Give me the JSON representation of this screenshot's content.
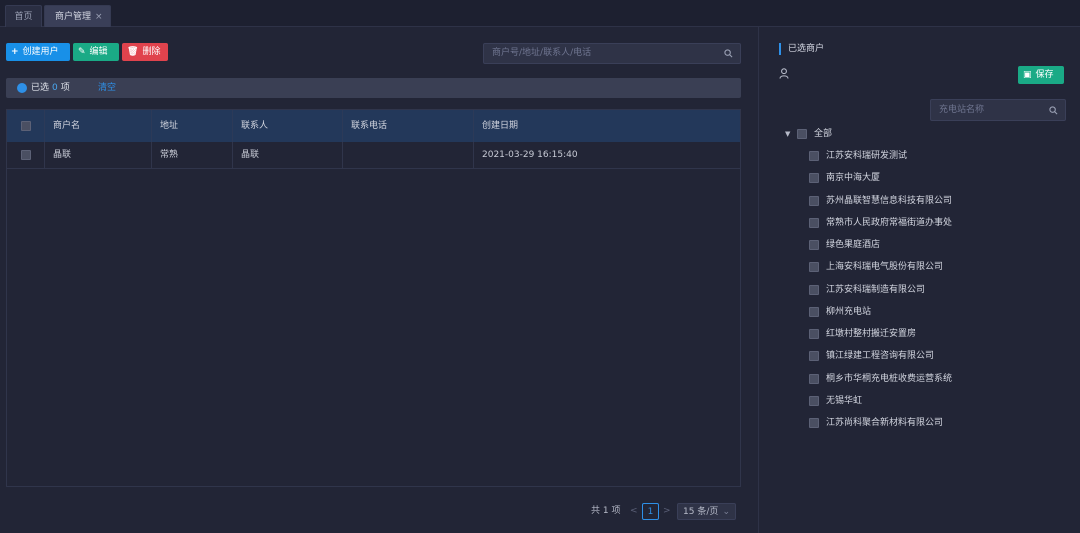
{
  "tabs": {
    "home": "首页",
    "active": "商户管理",
    "close": "×"
  },
  "toolbar": {
    "create_label": "创建用户",
    "edit_label": "编辑",
    "delete_label": "删除",
    "search_placeholder": "商户号/地址/联系人/电话"
  },
  "selection": {
    "prefix": "已选",
    "count": "0",
    "suffix": "项",
    "clear_label": "清空"
  },
  "table": {
    "headers": [
      "商户名",
      "地址",
      "联系人",
      "联系电话",
      "创建日期"
    ],
    "rows": [
      {
        "name": "晶联",
        "address": "常熟",
        "contact": "晶联",
        "phone": "",
        "created": "2021-03-29 16:15:40"
      }
    ]
  },
  "pagination": {
    "total": "共 1 项",
    "prev": "<",
    "current": "1",
    "next": ">",
    "page_size": "15 条/页"
  },
  "side": {
    "title": "已选商户",
    "save_label": "保存",
    "search_placeholder": "充电站名称",
    "tree_root": "全部",
    "stations": [
      "江苏安科瑞研发测试",
      "南京中海大厦",
      "苏州晶联智慧信息科技有限公司",
      "常熟市人民政府常福街道办事处",
      "绿色果庭酒店",
      "上海安科瑞电气股份有限公司",
      "江苏安科瑞制造有限公司",
      "柳州充电站",
      "红墩村整村搬迁安置房",
      "镇江绿建工程咨询有限公司",
      "桐乡市华桐充电桩收费运营系统",
      "无锡华虹",
      "江苏尚科聚合新材料有限公司"
    ]
  },
  "colors": {
    "accent": "#2e90e8",
    "create": "#1890e8",
    "edit": "#1aaa86",
    "delete": "#e0434d",
    "background": "#222536"
  }
}
